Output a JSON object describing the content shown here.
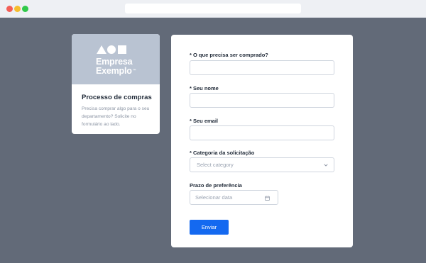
{
  "brand": {
    "logo_line1": "Empresa",
    "logo_line2": "Exemplo",
    "logo_mark": "™",
    "title": "Processo de compras",
    "description": "Precisa comprar algo para o seu departamento? Solicite no formulário ao lado."
  },
  "form": {
    "fields": {
      "item": {
        "label": "* O que precisa ser comprado?",
        "value": ""
      },
      "name": {
        "label": "* Seu nome",
        "value": ""
      },
      "email": {
        "label": "* Seu email",
        "value": ""
      },
      "category": {
        "label": "* Categoria da solicitação",
        "placeholder": "Select category"
      },
      "deadline": {
        "label": "Prazo de preferência",
        "placeholder": "Selecionar data"
      }
    },
    "submit_label": "Enviar"
  },
  "icons": {
    "dropdown": "chevron-down-icon",
    "date": "calendar-icon"
  },
  "colors": {
    "background": "#626a78",
    "brand_banner": "#b9c3d2",
    "primary_button": "#1469f0"
  }
}
